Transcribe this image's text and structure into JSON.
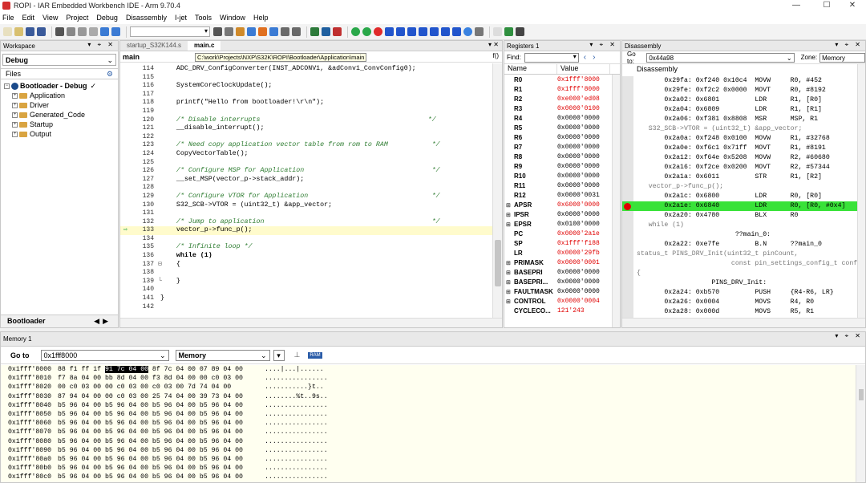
{
  "window": {
    "title": "ROPI - IAR Embedded Workbench IDE - Arm 9.70.4",
    "min": "—",
    "max": "☐",
    "close": "✕"
  },
  "menu": [
    "File",
    "Edit",
    "View",
    "Project",
    "Debug",
    "Disassembly",
    "I-jet",
    "Tools",
    "Window",
    "Help"
  ],
  "workspace": {
    "title": "Workspace",
    "config": "Debug",
    "files_label": "Files",
    "project": "Bootloader - Debug",
    "folders": [
      "Application",
      "Driver",
      "Generated_Code",
      "Startup",
      "Output"
    ],
    "footer_tab": "Bootloader"
  },
  "editor": {
    "tabs": [
      "startup_S32K144.s",
      "main.c"
    ],
    "function": "main",
    "scope_icon": "f()",
    "tooltip": "C:\\work\\Projects\\NXP\\S32K\\ROPI\\Bootloader\\Application\\main",
    "current_line": "133",
    "lines": [
      {
        "n": "114",
        "t": "    ADC_DRV_ConfigConverter(INST_ADCONV1, &adConv1_ConvConfig0);",
        "k": ""
      },
      {
        "n": "115",
        "t": "",
        "k": ""
      },
      {
        "n": "116",
        "t": "    SystemCoreClockUpdate();",
        "k": ""
      },
      {
        "n": "117",
        "t": "",
        "k": ""
      },
      {
        "n": "118",
        "t": "    printf(\"Hello from bootloader!\\r\\n\");",
        "k": ""
      },
      {
        "n": "119",
        "t": "",
        "k": ""
      },
      {
        "n": "120",
        "t": "    /* Disable interrupts                                          */",
        "k": "cm"
      },
      {
        "n": "121",
        "t": "    __disable_interrupt();",
        "k": ""
      },
      {
        "n": "122",
        "t": "",
        "k": ""
      },
      {
        "n": "123",
        "t": "    /* Need copy application vector table from rom to RAM           */",
        "k": "cm"
      },
      {
        "n": "124",
        "t": "    CopyVectorTable();",
        "k": ""
      },
      {
        "n": "125",
        "t": "",
        "k": ""
      },
      {
        "n": "126",
        "t": "    /* Configure MSP for Application                                */",
        "k": "cm"
      },
      {
        "n": "127",
        "t": "    __set_MSP(vector_p->stack_addr);",
        "k": ""
      },
      {
        "n": "128",
        "t": "",
        "k": ""
      },
      {
        "n": "129",
        "t": "    /* Configure VTOR for Application                               */",
        "k": "cm"
      },
      {
        "n": "130",
        "t": "    S32_SCB->VTOR = (uint32_t) &app_vector;",
        "k": ""
      },
      {
        "n": "131",
        "t": "",
        "k": ""
      },
      {
        "n": "132",
        "t": "    /* Jump to application                                          */",
        "k": "cm"
      },
      {
        "n": "133",
        "t": "    vector_p->func_p();",
        "k": "cur"
      },
      {
        "n": "134",
        "t": "",
        "k": ""
      },
      {
        "n": "135",
        "t": "    /* Infinite loop */",
        "k": "cm"
      },
      {
        "n": "136",
        "t": "    while (1)",
        "k": "kw"
      },
      {
        "n": "137",
        "t": "    {",
        "k": ""
      },
      {
        "n": "138",
        "t": "",
        "k": ""
      },
      {
        "n": "139",
        "t": "    }",
        "k": ""
      },
      {
        "n": "140",
        "t": "",
        "k": ""
      },
      {
        "n": "141",
        "t": "}",
        "k": ""
      },
      {
        "n": "142",
        "t": "",
        "k": ""
      }
    ]
  },
  "registers": {
    "title": "Registers 1",
    "find_label": "Find:",
    "col_name": "Name",
    "col_value": "Value",
    "rows": [
      {
        "n": "R0",
        "v": "0x1fff'8000",
        "red": true,
        "exp": false
      },
      {
        "n": "R1",
        "v": "0x1fff'8000",
        "red": true,
        "exp": false
      },
      {
        "n": "R2",
        "v": "0xe000'ed08",
        "red": true,
        "exp": false
      },
      {
        "n": "R3",
        "v": "0x0000'0100",
        "red": true,
        "exp": false
      },
      {
        "n": "R4",
        "v": "0x0000'0000",
        "red": false,
        "exp": false
      },
      {
        "n": "R5",
        "v": "0x0000'0000",
        "red": false,
        "exp": false
      },
      {
        "n": "R6",
        "v": "0x0000'0000",
        "red": false,
        "exp": false
      },
      {
        "n": "R7",
        "v": "0x0000'0000",
        "red": false,
        "exp": false
      },
      {
        "n": "R8",
        "v": "0x0000'0000",
        "red": false,
        "exp": false
      },
      {
        "n": "R9",
        "v": "0x0000'0000",
        "red": false,
        "exp": false
      },
      {
        "n": "R10",
        "v": "0x0000'0000",
        "red": false,
        "exp": false
      },
      {
        "n": "R11",
        "v": "0x0000'0000",
        "red": false,
        "exp": false
      },
      {
        "n": "R12",
        "v": "0x0000'0031",
        "red": false,
        "exp": false
      },
      {
        "n": "APSR",
        "v": "0x6000'0000",
        "red": true,
        "exp": true
      },
      {
        "n": "IPSR",
        "v": "0x0000'0000",
        "red": false,
        "exp": true
      },
      {
        "n": "EPSR",
        "v": "0x0100'0000",
        "red": false,
        "exp": true
      },
      {
        "n": "PC",
        "v": "0x0000'2a1e",
        "red": true,
        "exp": false
      },
      {
        "n": "SP",
        "v": "0x1fff'f188",
        "red": true,
        "exp": false
      },
      {
        "n": "LR",
        "v": "0x0000'29fb",
        "red": true,
        "exp": false
      },
      {
        "n": "PRIMASK",
        "v": "0x0000'0001",
        "red": true,
        "exp": true
      },
      {
        "n": "BASEPRI",
        "v": "0x0000'0000",
        "red": false,
        "exp": true
      },
      {
        "n": "BASEPRI...",
        "v": "0x0000'0000",
        "red": false,
        "exp": true
      },
      {
        "n": "FAULTMASK",
        "v": "0x0000'0000",
        "red": false,
        "exp": true
      },
      {
        "n": "CONTROL",
        "v": "0x0000'0004",
        "red": true,
        "exp": true
      },
      {
        "n": "CYCLECO...",
        "v": "121'243",
        "red": true,
        "exp": false
      }
    ]
  },
  "disassembly": {
    "title": "Disassembly",
    "goto_label": "Go to:",
    "goto_value": "0x44a98",
    "zone_label": "Zone:",
    "zone_value": "Memory",
    "col": "Disassembly",
    "rows": [
      {
        "t": "       0x29fa: 0xf240 0x10c4  MOVW     R0, #452",
        "k": ""
      },
      {
        "t": "       0x29fe: 0xf2c2 0x0000  MOVT     R0, #8192",
        "k": ""
      },
      {
        "t": "       0x2a02: 0x6801         LDR      R1, [R0]",
        "k": ""
      },
      {
        "t": "       0x2a04: 0x6809         LDR      R1, [R1]",
        "k": ""
      },
      {
        "t": "       0x2a06: 0xf381 0x8808  MSR      MSP, R1",
        "k": ""
      },
      {
        "t": "   S32_SCB->VTOR = (uint32_t) &app_vector;",
        "k": "src"
      },
      {
        "t": "       0x2a0a: 0xf248 0x0100  MOVW     R1, #32768",
        "k": ""
      },
      {
        "t": "       0x2a0e: 0xf6c1 0x71ff  MOVT     R1, #8191",
        "k": ""
      },
      {
        "t": "       0x2a12: 0xf64e 0x5208  MOVW     R2, #60680",
        "k": ""
      },
      {
        "t": "       0x2a16: 0xf2ce 0x0200  MOVT     R2, #57344",
        "k": ""
      },
      {
        "t": "       0x2a1a: 0x6011         STR      R1, [R2]",
        "k": ""
      },
      {
        "t": "   vector_p->func_p();",
        "k": "src"
      },
      {
        "t": "       0x2a1c: 0x6800         LDR      R0, [R0]",
        "k": ""
      },
      {
        "t": "       0x2a1e: 0x6840         LDR      R0, [R0, #0x4]",
        "k": "hl"
      },
      {
        "t": "       0x2a20: 0x4780         BLX      R0",
        "k": ""
      },
      {
        "t": "   while (1)",
        "k": "src"
      },
      {
        "t": "                         ??main_0:",
        "k": ""
      },
      {
        "t": "       0x2a22: 0xe7fe         B.N      ??main_0",
        "k": ""
      },
      {
        "t": "status_t PINS_DRV_Init(uint32_t pinCount,",
        "k": "src"
      },
      {
        "t": "                        const pin_settings_config_t confi",
        "k": "src"
      },
      {
        "t": "{",
        "k": "src"
      },
      {
        "t": "                   PINS_DRV_Init:",
        "k": ""
      },
      {
        "t": "       0x2a24: 0xb570         PUSH     {R4-R6, LR}",
        "k": ""
      },
      {
        "t": "       0x2a26: 0x0004         MOVS     R4, R0",
        "k": ""
      },
      {
        "t": "       0x2a28: 0x000d         MOVS     R5, R1",
        "k": ""
      }
    ]
  },
  "memory": {
    "title": "Memory 1",
    "goto_label": "Go to",
    "goto_value": "0x1fff8000",
    "zone_value": "Memory",
    "rows": [
      {
        "a": "0x1fff'8000",
        "b1": "88 f1 ff 1f ",
        "bs": "91 7c 04 00",
        "b2": " 8f 7c 04 00 07 89 04 00",
        "s": "....|...|......"
      },
      {
        "a": "0x1fff'8010",
        "b1": "f7 8a 04 00 bb 8d 04 00 f3 8d 04 00 00 c0 03 00",
        "bs": "",
        "b2": "",
        "s": "................"
      },
      {
        "a": "0x1fff'8020",
        "b1": "00 c0 03 00 00 c0 03 00 c0 03 00 7d 74 04 00",
        "bs": "",
        "b2": "",
        "s": "...........}t.."
      },
      {
        "a": "0x1fff'8030",
        "b1": "87 94 04 00 00 c0 03 00 25 74 04 00 39 73 04 00",
        "bs": "",
        "b2": "",
        "s": "........%t..9s.."
      },
      {
        "a": "0x1fff'8040",
        "b1": "b5 96 04 00 b5 96 04 00 b5 96 04 00 b5 96 04 00",
        "bs": "",
        "b2": "",
        "s": "................"
      },
      {
        "a": "0x1fff'8050",
        "b1": "b5 96 04 00 b5 96 04 00 b5 96 04 00 b5 96 04 00",
        "bs": "",
        "b2": "",
        "s": "................"
      },
      {
        "a": "0x1fff'8060",
        "b1": "b5 96 04 00 b5 96 04 00 b5 96 04 00 b5 96 04 00",
        "bs": "",
        "b2": "",
        "s": "................"
      },
      {
        "a": "0x1fff'8070",
        "b1": "b5 96 04 00 b5 96 04 00 b5 96 04 00 b5 96 04 00",
        "bs": "",
        "b2": "",
        "s": "................"
      },
      {
        "a": "0x1fff'8080",
        "b1": "b5 96 04 00 b5 96 04 00 b5 96 04 00 b5 96 04 00",
        "bs": "",
        "b2": "",
        "s": "................"
      },
      {
        "a": "0x1fff'8090",
        "b1": "b5 96 04 00 b5 96 04 00 b5 96 04 00 b5 96 04 00",
        "bs": "",
        "b2": "",
        "s": "................"
      },
      {
        "a": "0x1fff'80a0",
        "b1": "b5 96 04 00 b5 96 04 00 b5 96 04 00 b5 96 04 00",
        "bs": "",
        "b2": "",
        "s": "................"
      },
      {
        "a": "0x1fff'80b0",
        "b1": "b5 96 04 00 b5 96 04 00 b5 96 04 00 b5 96 04 00",
        "bs": "",
        "b2": "",
        "s": "................"
      },
      {
        "a": "0x1fff'80c0",
        "b1": "b5 96 04 00 b5 96 04 00 b5 96 04 00 b5 96 04 00",
        "bs": "",
        "b2": "",
        "s": "................"
      }
    ]
  },
  "colors": {
    "accent_red": "#e00000",
    "highlight_green": "#39e239",
    "memory_bg": "#fffff0"
  }
}
